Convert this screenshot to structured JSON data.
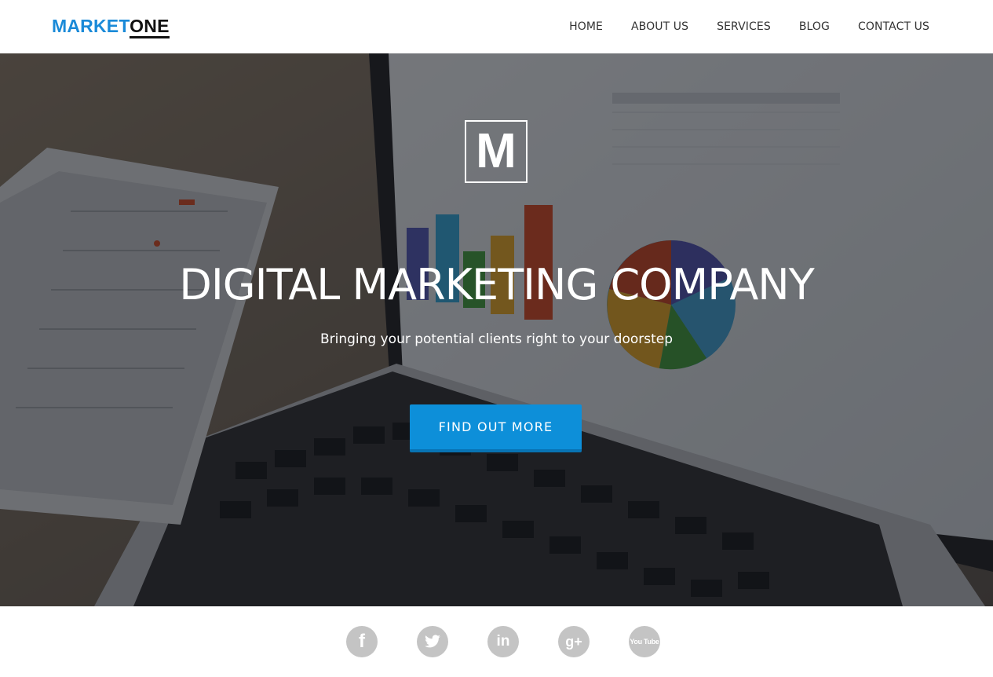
{
  "brand": {
    "logo_part1": "MARKET",
    "logo_part2": "ONE",
    "accent": "#1a8ad8"
  },
  "nav": {
    "items": [
      {
        "label": "HOME"
      },
      {
        "label": "ABOUT US"
      },
      {
        "label": "SERVICES"
      },
      {
        "label": "BLOG"
      },
      {
        "label": "CONTACT US"
      }
    ]
  },
  "hero": {
    "badge_letter": "M",
    "title": "DIGITAL MARKETING COMPANY",
    "subtitle": "Bringing your potential clients right to your doorstep",
    "cta_label": "FIND OUT MORE",
    "cta_color": "#0d8fd9"
  },
  "social": {
    "items": [
      {
        "icon": "facebook-icon",
        "glyph": "f"
      },
      {
        "icon": "twitter-icon",
        "glyph": ""
      },
      {
        "icon": "linkedin-icon",
        "glyph": "in"
      },
      {
        "icon": "google-plus-icon",
        "glyph": "g+"
      },
      {
        "icon": "youtube-icon",
        "glyph": "You Tube"
      }
    ],
    "color": "#c4c4c4"
  }
}
